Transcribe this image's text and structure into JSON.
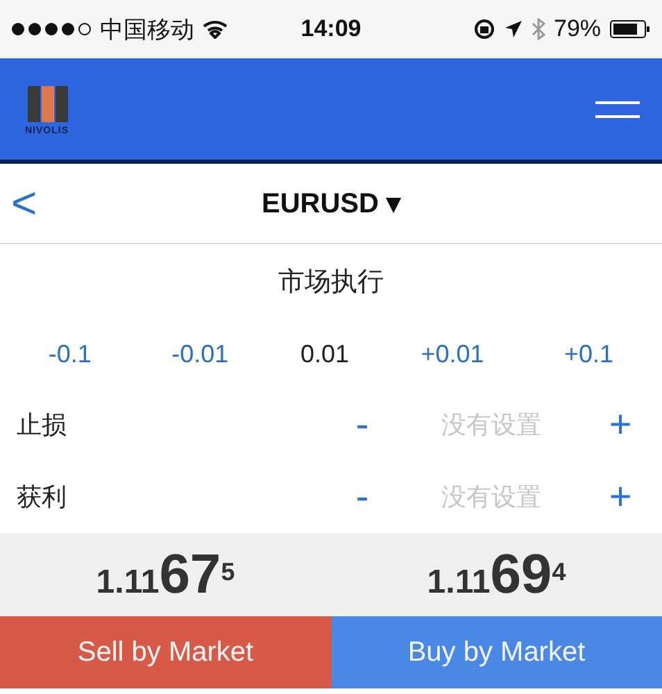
{
  "status_bar": {
    "carrier": "中国移动",
    "time": "14:09",
    "battery": "79%"
  },
  "header": {
    "brand": "NIVOLIS"
  },
  "nav": {
    "back": "<",
    "title": "EURUSD ▾"
  },
  "mode": "市场执行",
  "steps": [
    {
      "label": "-0.1",
      "kind": "step"
    },
    {
      "label": "-0.01",
      "kind": "step"
    },
    {
      "label": "0.01",
      "kind": "volume"
    },
    {
      "label": "+0.01",
      "kind": "step"
    },
    {
      "label": "+0.1",
      "kind": "step"
    }
  ],
  "levels": [
    {
      "label": "止损",
      "minus": "-",
      "placeholder": "没有设置",
      "plus": "+"
    },
    {
      "label": "获利",
      "minus": "-",
      "placeholder": "没有设置",
      "plus": "+"
    }
  ],
  "prices": [
    {
      "head": "1.11",
      "big": "67",
      "tail": "5"
    },
    {
      "head": "1.11",
      "big": "69",
      "tail": "4"
    }
  ],
  "actions": [
    {
      "label": "Sell by Market",
      "kind": "sell"
    },
    {
      "label": "Buy by Market",
      "kind": "buy"
    }
  ]
}
